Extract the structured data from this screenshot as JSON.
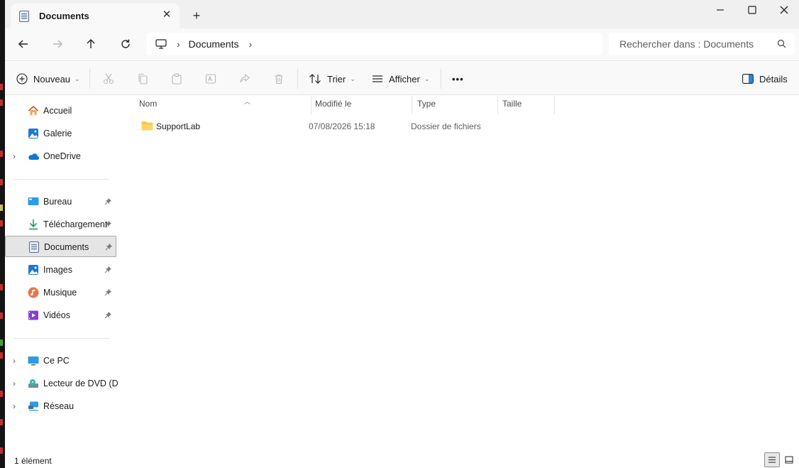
{
  "window": {
    "tab_title": "Documents",
    "tab_close": "✕",
    "new_tab": "+"
  },
  "address": {
    "crumbs": [
      "Documents"
    ],
    "search_placeholder": "Rechercher dans : Documents"
  },
  "commands": {
    "new_label": "Nouveau",
    "sort_label": "Trier",
    "view_label": "Afficher",
    "more_label": "•••",
    "details_label": "Détails"
  },
  "nav": {
    "quick": [
      {
        "label": "Accueil",
        "icon": "home-icon"
      },
      {
        "label": "Galerie",
        "icon": "gallery-icon"
      },
      {
        "label": "OneDrive",
        "icon": "onedrive-icon",
        "expandable": true
      }
    ],
    "pinned": [
      {
        "label": "Bureau",
        "icon": "desktop-icon"
      },
      {
        "label": "Téléchargement",
        "icon": "download-icon"
      },
      {
        "label": "Documents",
        "icon": "documents-icon",
        "selected": true
      },
      {
        "label": "Images",
        "icon": "pictures-icon"
      },
      {
        "label": "Musique",
        "icon": "music-icon"
      },
      {
        "label": "Vidéos",
        "icon": "videos-icon"
      }
    ],
    "devices": [
      {
        "label": "Ce PC",
        "icon": "this-pc-icon"
      },
      {
        "label": "Lecteur de DVD (D:)",
        "icon": "dvd-drive-icon"
      },
      {
        "label": "Réseau",
        "icon": "network-icon"
      }
    ]
  },
  "columns": {
    "name": "Nom",
    "modified": "Modifié le",
    "type": "Type",
    "size": "Taille"
  },
  "files": [
    {
      "name": "SupportLab",
      "modified": "07/08/2026 15:18",
      "type": "Dossier de fichiers",
      "size": ""
    }
  ],
  "status": {
    "count": "1 élément"
  },
  "colors": {
    "accent": "#0067c0",
    "folder": "#f8c543",
    "selected_bg": "#e5e5e5"
  }
}
